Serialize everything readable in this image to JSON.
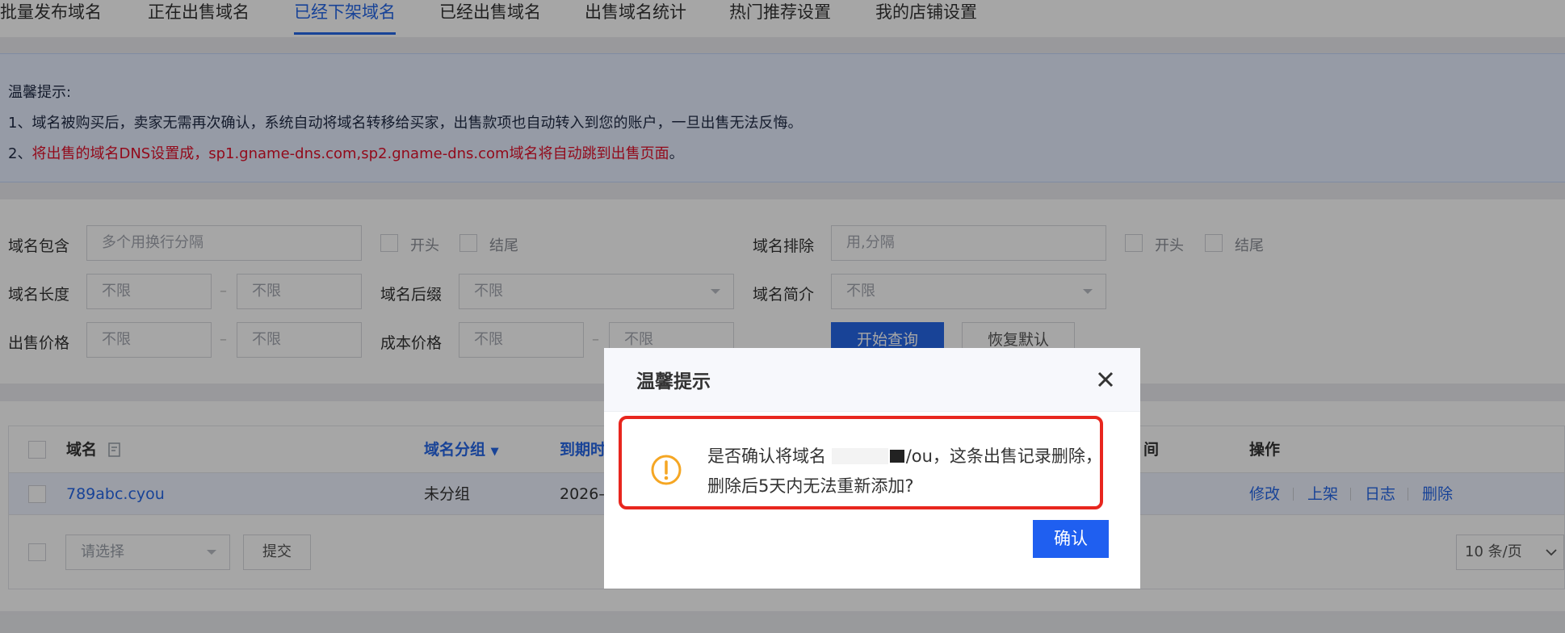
{
  "tabs": [
    {
      "label": "批量发布域名"
    },
    {
      "label": "正在出售域名"
    },
    {
      "label": "已经下架域名",
      "active": true
    },
    {
      "label": "已经出售域名"
    },
    {
      "label": "出售域名统计"
    },
    {
      "label": "热门推荐设置"
    },
    {
      "label": "我的店铺设置"
    }
  ],
  "notice": {
    "title": "温馨提示:",
    "line1": "1、域名被购买后，卖家无需再次确认，系统自动将域名转移给买家，出售款项也自动转入到您的账户，一旦出售无法反悔。",
    "line2_prefix": "2、",
    "line2_red": "将出售的域名DNS设置成，sp1.gname-dns.com,sp2.gname-dns.com域名将自动跳到出售页面",
    "line2_suffix": "。"
  },
  "filter": {
    "contains_label": "域名包含",
    "contains_placeholder": "多个用换行分隔",
    "start_label": "开头",
    "end_label": "结尾",
    "exclude_label": "域名排除",
    "exclude_placeholder": "用,分隔",
    "length_label": "域名长度",
    "unlimited": "不限",
    "suffix_label": "域名后缀",
    "intro_label": "域名简介",
    "price_label": "出售价格",
    "cost_label": "成本价格",
    "dash": "–",
    "search_button": "开始查询",
    "reset_button": "恢复默认"
  },
  "table": {
    "col_domain": "域名",
    "col_group": "域名分组",
    "col_expire": "到期时",
    "col_time": "间",
    "col_ops": "操作",
    "rows": [
      {
        "domain": "789abc.cyou",
        "group": "未分组",
        "expire": "2026–",
        "ops": [
          "修改",
          "上架",
          "日志",
          "删除"
        ]
      }
    ],
    "bulk_placeholder": "请选择",
    "submit_button": "提交",
    "page_size": "10 条/页"
  },
  "dialog": {
    "title": "温馨提示",
    "message_part1": "是否确认将域名",
    "message_part2": "/ou，这条出售记录删除，",
    "message_line2": "删除后5天内无法重新添加?",
    "confirm_button": "确认"
  },
  "colors": {
    "primary": "#2667e8",
    "warning": "#f5a623",
    "highlight_border": "#e8261e",
    "notice_red": "#e1102a"
  }
}
